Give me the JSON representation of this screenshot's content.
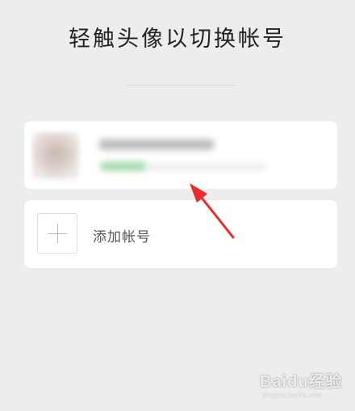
{
  "header": {
    "title": "轻触头像以切换帐号"
  },
  "accounts": {
    "add_label": "添加帐号"
  },
  "watermark": {
    "brand": "Baidu经验",
    "url": "jingyan.baidu.com"
  },
  "colors": {
    "background": "#ededed",
    "card": "#ffffff",
    "arrow": "#ee2b2b"
  },
  "icons": {
    "add": "plus-icon"
  }
}
